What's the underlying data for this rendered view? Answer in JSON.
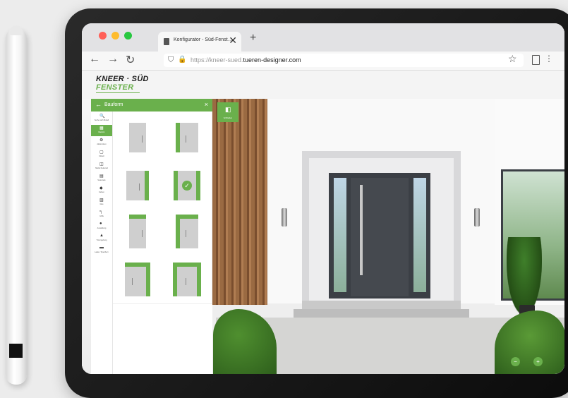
{
  "browser": {
    "tab_title": "Konfigurator - Süd-Fenst…",
    "tab_close": "✕",
    "new_tab": "+",
    "back": "←",
    "forward": "→",
    "reload": "↻",
    "url_prefix": "https://kneer-sued.",
    "url_domain": "tueren-designer.com",
    "bookmark": "☆",
    "menu": "⋮"
  },
  "brand": {
    "line1": "KNEER · SÜD",
    "line2": "FENSTER"
  },
  "panel": {
    "back": "←",
    "title": "Bauform",
    "close": "×",
    "nav": [
      {
        "glyph": "🔍",
        "label": "Suche nach Modell"
      },
      {
        "glyph": "▦",
        "label": "Bauform"
      },
      {
        "glyph": "⚙",
        "label": "Aktionstüren"
      },
      {
        "glyph": "▢",
        "label": "Modell"
      },
      {
        "glyph": "◫",
        "label": "Modell Seitenteil"
      },
      {
        "glyph": "▤",
        "label": "Seitenteile"
      },
      {
        "glyph": "◆",
        "label": "Farben"
      },
      {
        "glyph": "▥",
        "label": "Glas"
      },
      {
        "glyph": "╕",
        "label": "Griffe"
      },
      {
        "glyph": "●",
        "label": "Ausstattung"
      },
      {
        "glyph": "▲",
        "label": "Türumgebung"
      },
      {
        "glyph": "▬",
        "label": "Laden / Speichern"
      }
    ],
    "variants": [
      "door",
      "door-sidelight-left",
      "door-sidelight-right",
      "door-sidelight-right-selected",
      "door-top",
      "door-top-sidelight-left",
      "door-top-sidelight-right",
      "door-top-both"
    ]
  },
  "scene": {
    "close_label": "Schließen",
    "close_glyph": "◧",
    "zoom_out": "−",
    "zoom_in": "+"
  },
  "colors": {
    "accent": "#6ab04c",
    "door": "#45494f"
  }
}
